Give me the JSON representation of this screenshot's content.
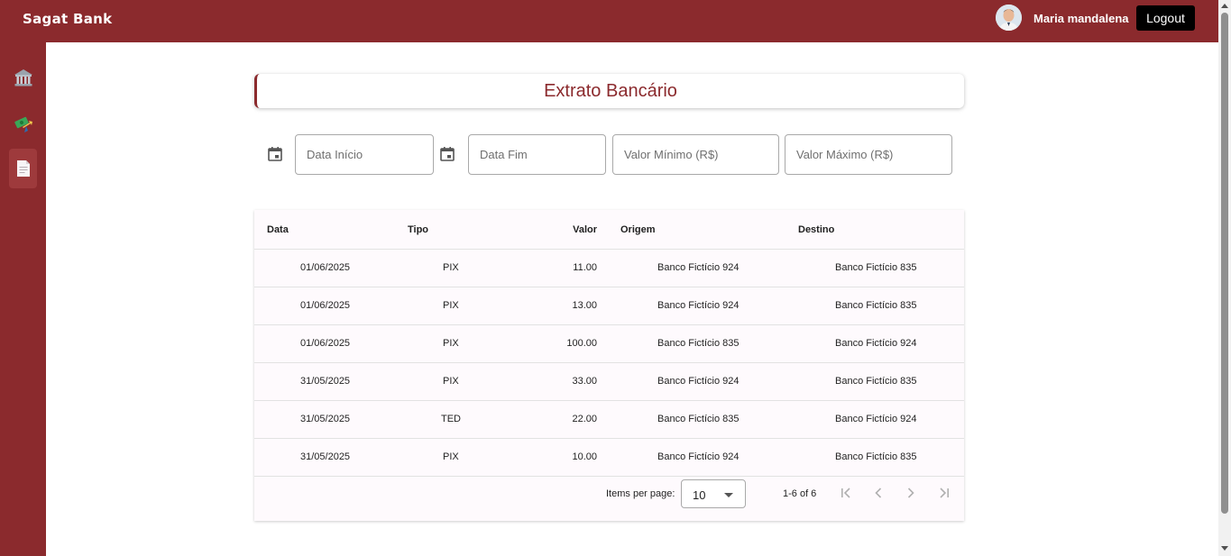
{
  "header": {
    "brand": "Sagat Bank",
    "username": "Maria mandalena",
    "logout_label": "Logout"
  },
  "sidebar": {
    "items": [
      {
        "icon": "bank-icon",
        "active": false
      },
      {
        "icon": "money-transfer-icon",
        "active": false
      },
      {
        "icon": "document-icon",
        "active": true
      }
    ]
  },
  "page": {
    "title": "Extrato Bancário"
  },
  "filters": {
    "start_date_placeholder": "Data Início",
    "end_date_placeholder": "Data Fim",
    "min_value_placeholder": "Valor Mínimo (R$)",
    "max_value_placeholder": "Valor Máximo (R$)"
  },
  "table": {
    "columns": [
      "Data",
      "Tipo",
      "Valor",
      "Origem",
      "Destino"
    ],
    "rows": [
      [
        "01/06/2025",
        "PIX",
        "11.00",
        "Banco Fictício 924",
        "Banco Fictício 835"
      ],
      [
        "01/06/2025",
        "PIX",
        "13.00",
        "Banco Fictício 924",
        "Banco Fictício 835"
      ],
      [
        "01/06/2025",
        "PIX",
        "100.00",
        "Banco Fictício 835",
        "Banco Fictício 924"
      ],
      [
        "31/05/2025",
        "PIX",
        "33.00",
        "Banco Fictício 924",
        "Banco Fictício 835"
      ],
      [
        "31/05/2025",
        "TED",
        "22.00",
        "Banco Fictício 835",
        "Banco Fictício 924"
      ],
      [
        "31/05/2025",
        "PIX",
        "10.00",
        "Banco Fictício 924",
        "Banco Fictício 835"
      ]
    ]
  },
  "paginator": {
    "items_per_page_label": "Items per page:",
    "items_per_page_value": "10",
    "range_label": "1-6 of 6"
  },
  "colors": {
    "brand": "#8b2a2d",
    "table_bg": "#fefafd"
  }
}
